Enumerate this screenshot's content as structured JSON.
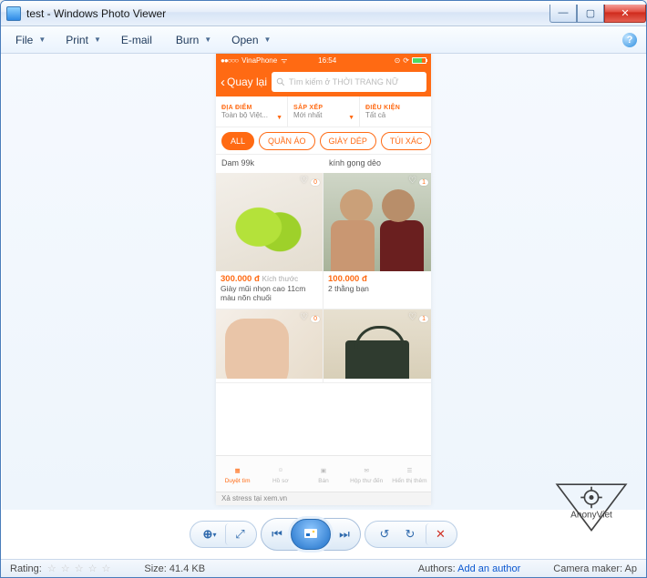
{
  "window": {
    "title": "test - Windows Photo Viewer"
  },
  "menu": {
    "file": "File",
    "print": "Print",
    "email": "E-mail",
    "burn": "Burn",
    "open": "Open"
  },
  "phone": {
    "carrier": "VinaPhone",
    "time": "16:54",
    "back": "Quay lại",
    "search_placeholder": "Tìm kiếm ở THỜI TRANG NỮ",
    "filters": [
      {
        "label": "ĐỊA ĐIỂM",
        "value": "Toàn bộ Việt..."
      },
      {
        "label": "SẮP XẾP",
        "value": "Mới nhất"
      },
      {
        "label": "ĐIỀU KIỆN",
        "value": "Tất cả"
      }
    ],
    "chips": [
      "ALL",
      "QUẦN ÁO",
      "GIÀY DÉP",
      "TÚI XÁC"
    ],
    "row_titles": [
      "Dam 99k",
      "kính gọng dẻo"
    ],
    "products": [
      {
        "price": "300.000 đ",
        "extra": "Kích thước",
        "name": "Giày mũi nhọn cao 11cm màu nõn chuối",
        "likes": "0"
      },
      {
        "price": "100.000 đ",
        "extra": "",
        "name": "2 thằng bạn",
        "likes": "1"
      },
      {
        "price": "",
        "extra": "",
        "name": "",
        "likes": "0"
      },
      {
        "price": "",
        "extra": "",
        "name": "",
        "likes": "1"
      }
    ],
    "tabs": [
      {
        "label": "Duyệt tìm"
      },
      {
        "label": "Hồ sơ"
      },
      {
        "label": "Bán"
      },
      {
        "label": "Hộp thư đến"
      },
      {
        "label": "Hiển thị thêm"
      }
    ],
    "footer": "Xả stress tại xem.vn"
  },
  "status": {
    "rating_label": "Rating:",
    "size_label": "Size:",
    "size_value": "41.4 KB",
    "authors_label": "Authors:",
    "authors_value": "Add an author",
    "camera_label": "Camera maker:",
    "camera_value": "Ap"
  },
  "watermark": "AnonyViet"
}
